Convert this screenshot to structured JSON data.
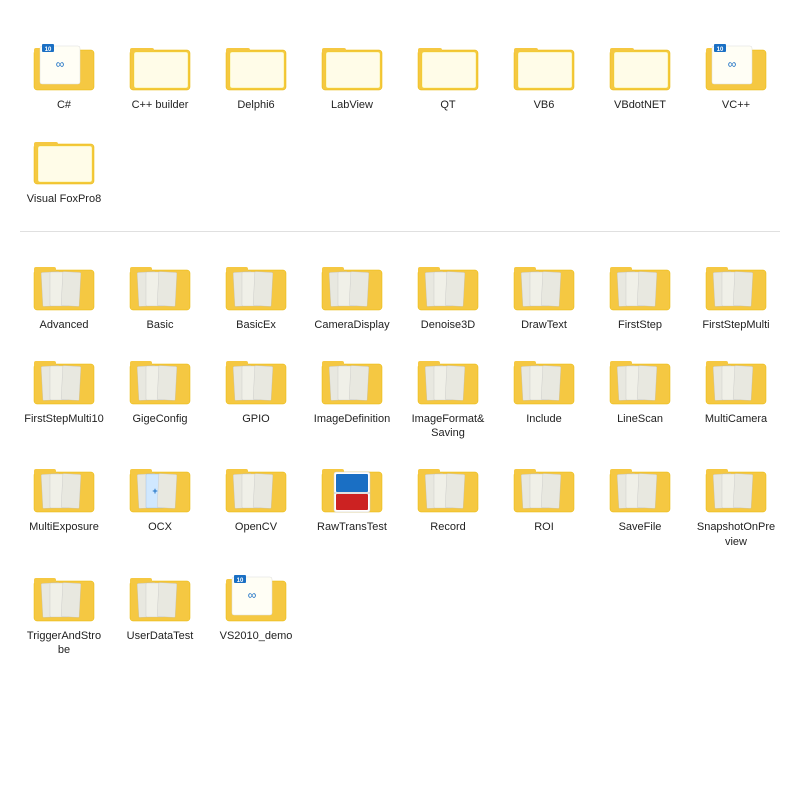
{
  "sections": [
    {
      "id": "sdk-languages",
      "items": [
        {
          "label": "C#",
          "type": "special-badge",
          "badge": "10",
          "has_infinity": true
        },
        {
          "label": "C++ builder",
          "type": "plain"
        },
        {
          "label": "Delphi6",
          "type": "plain"
        },
        {
          "label": "LabView",
          "type": "plain"
        },
        {
          "label": "QT",
          "type": "plain"
        },
        {
          "label": "VB6",
          "type": "plain"
        },
        {
          "label": "VBdotNET",
          "type": "plain"
        },
        {
          "label": "VC++",
          "type": "special-badge",
          "badge": "10",
          "has_infinity": true
        },
        {
          "label": "Visual FoxPro8",
          "type": "plain"
        }
      ]
    },
    {
      "id": "examples",
      "items": [
        {
          "label": "Advanced",
          "type": "example"
        },
        {
          "label": "Basic",
          "type": "example"
        },
        {
          "label": "BasicEx",
          "type": "example"
        },
        {
          "label": "CameraDisplay",
          "type": "example"
        },
        {
          "label": "Denoise3D",
          "type": "example"
        },
        {
          "label": "DrawText",
          "type": "example"
        },
        {
          "label": "FirstStep",
          "type": "example"
        },
        {
          "label": "FirstStepMulti",
          "type": "example"
        },
        {
          "label": "FirstStepMulti10",
          "type": "example"
        },
        {
          "label": "GigeConfig",
          "type": "example"
        },
        {
          "label": "GPIO",
          "type": "example"
        },
        {
          "label": "ImageDefinition",
          "type": "example"
        },
        {
          "label": "ImageFormat&Saving",
          "type": "example"
        },
        {
          "label": "Include",
          "type": "example"
        },
        {
          "label": "LineScan",
          "type": "example"
        },
        {
          "label": "MultiCamera",
          "type": "example"
        },
        {
          "label": "MultiExposure",
          "type": "example"
        },
        {
          "label": "OCX",
          "type": "example-blue"
        },
        {
          "label": "OpenCV",
          "type": "example"
        },
        {
          "label": "RawTransTest",
          "type": "example-special"
        },
        {
          "label": "Record",
          "type": "example"
        },
        {
          "label": "ROI",
          "type": "example"
        },
        {
          "label": "SaveFile",
          "type": "example"
        },
        {
          "label": "SnapshotOnPreview",
          "type": "example"
        },
        {
          "label": "TriggerAndStrobe",
          "type": "example"
        },
        {
          "label": "UserDataTest",
          "type": "example"
        },
        {
          "label": "VS2010_demo",
          "type": "special-badge",
          "badge": "10",
          "has_infinity": true
        }
      ]
    }
  ]
}
